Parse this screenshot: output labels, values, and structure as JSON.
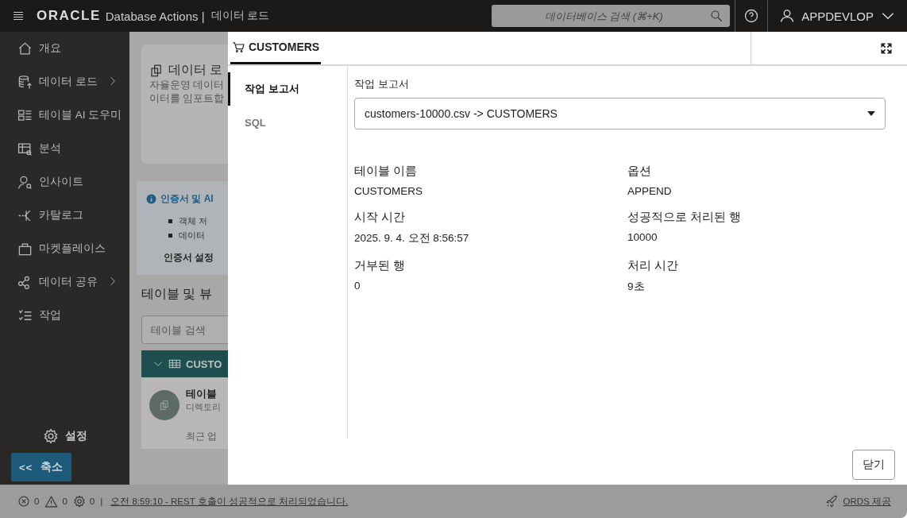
{
  "header": {
    "logo": "ORACLE",
    "app": "Database Actions |",
    "page": "데이터 로드",
    "search": {
      "placeholder": "데이터베이스 검색 (⌘+K)"
    },
    "user": "APPDEVLOP"
  },
  "sidebar": {
    "items": [
      {
        "label": "개요",
        "expandable": false
      },
      {
        "label": "데이터 로드",
        "expandable": true
      },
      {
        "label": "테이블 AI 도우미",
        "expandable": false
      },
      {
        "label": "분석",
        "expandable": false
      },
      {
        "label": "인사이트",
        "expandable": false
      },
      {
        "label": "카탈로그",
        "expandable": false
      },
      {
        "label": "마켓플레이스",
        "expandable": false
      },
      {
        "label": "데이터 공유",
        "expandable": true
      },
      {
        "label": "작업",
        "expandable": false
      }
    ],
    "settings": "설정",
    "collapse": {
      "icon": "<<",
      "label": "축소"
    }
  },
  "background": {
    "card_title": "데이터 로",
    "card_lines": [
      "자율운영 데이터",
      "이터를 임포트합"
    ],
    "notice_title": "인증서 및 AI",
    "notice_items": [
      "객체 저",
      "데이터"
    ],
    "notice_link": "인증서 설정",
    "section_title": "테이블 및 뷰",
    "search": {
      "placeholder": "테이블 검색"
    },
    "tree_item": "CUSTO",
    "item_title": "테이블",
    "item_text": "디렉토리",
    "item_meta": "최근 업"
  },
  "drawer": {
    "tab": {
      "label": "CUSTOMERS",
      "selected": true
    },
    "nav": [
      {
        "label": "작업 보고서",
        "selected": true
      },
      {
        "label": "SQL",
        "selected": false
      }
    ],
    "report_label": "작업 보고서",
    "job_select": {
      "value": "customers-10000.csv -> CUSTOMERS"
    },
    "fields": [
      {
        "label": "테이블 이름",
        "value": "CUSTOMERS"
      },
      {
        "label": "옵션",
        "value": "APPEND"
      },
      {
        "label": "시작 시간",
        "value": "2025. 9. 4. 오전 8:56:57"
      },
      {
        "label": "성공적으로 처리된 행",
        "value": "10000"
      },
      {
        "label": "거부된 행",
        "value": "0"
      },
      {
        "label": "처리 시간",
        "value": "9초"
      }
    ],
    "close_button": "닫기"
  },
  "status_bar": {
    "errors": "0",
    "warnings": "0",
    "settings": "0",
    "separator": "|",
    "message": "오전 8:59:10 - REST 호출이 성공적으로 처리되었습니다.",
    "provider": "ORDS 제공"
  }
}
